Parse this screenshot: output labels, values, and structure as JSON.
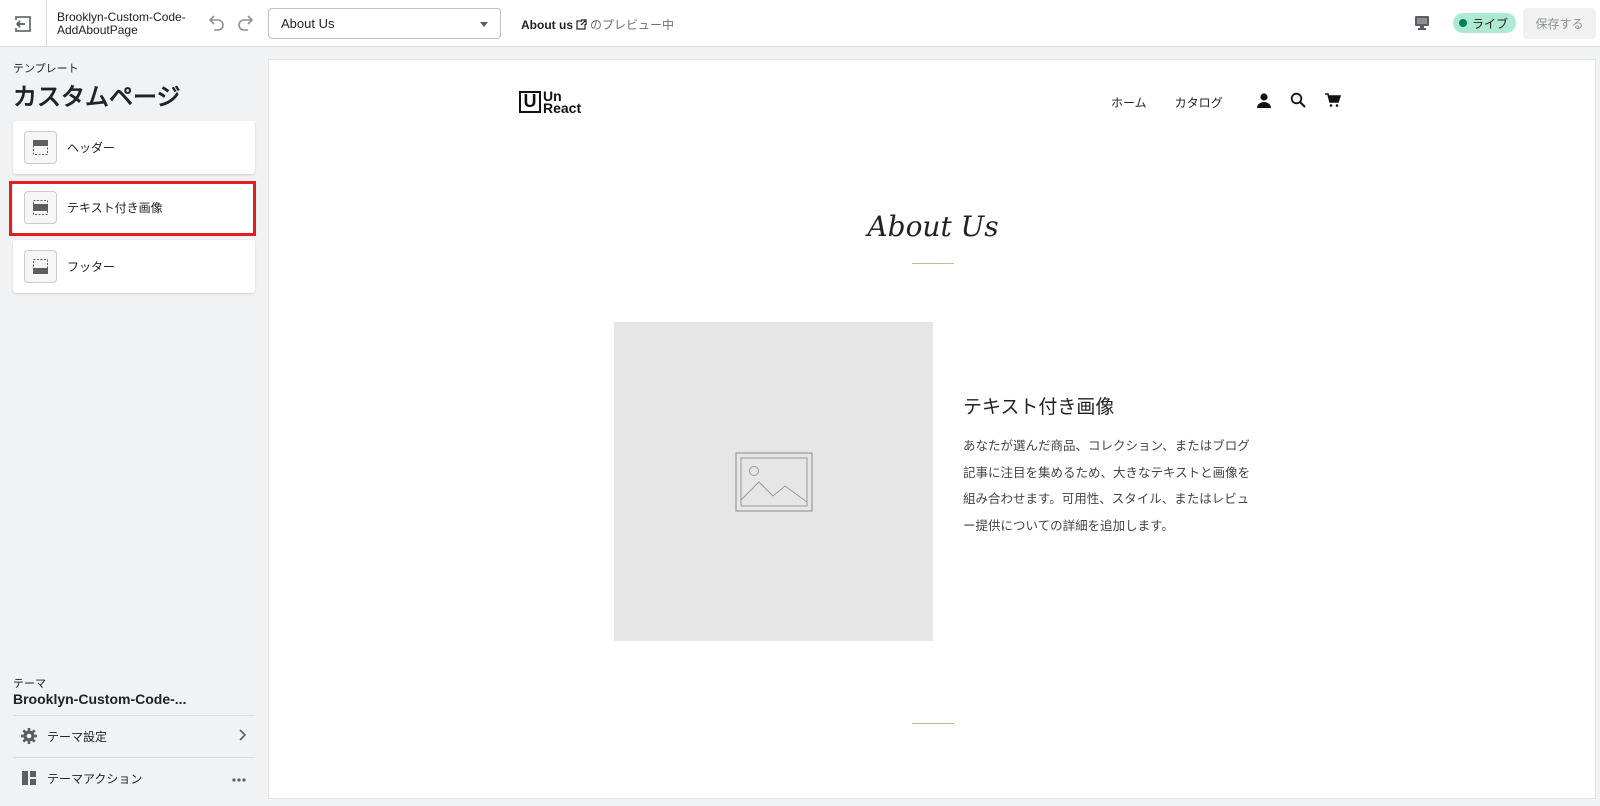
{
  "topbar": {
    "exit_icon": "exit-icon",
    "theme_name": "Brooklyn-Custom-Code-AddAboutPage",
    "undo_icon": "undo-icon",
    "redo_icon": "redo-icon",
    "page_select": {
      "selected": "About Us"
    },
    "preview_page": "About us",
    "preview_suffix": "のプレビュー中",
    "device_icon": "desktop-icon",
    "live_label": "ライブ",
    "save_label": "保存する"
  },
  "sidebar": {
    "template_label": "テンプレート",
    "template_title": "カスタムページ",
    "sections": [
      {
        "label": "ヘッダー",
        "icon": "header-section-icon"
      },
      {
        "label": "テキスト付き画像",
        "icon": "image-with-text-section-icon",
        "highlighted": true
      },
      {
        "label": "フッター",
        "icon": "footer-section-icon"
      }
    ],
    "theme_label": "テーマ",
    "theme_name": "Brooklyn-Custom-Code-...",
    "theme_settings_label": "テーマ設定",
    "theme_actions_label": "テーマアクション"
  },
  "preview": {
    "logo_text_line1": "Un",
    "logo_text_line2": "React",
    "nav": [
      "ホーム",
      "カタログ"
    ],
    "page_heading": "About Us",
    "image_with_text": {
      "heading": "テキスト付き画像",
      "body": "あなたが選んだ商品、コレクション、またはブログ記事に注目を集めるため、大きなテキストと画像を組み合わせます。可用性、スタイル、またはレビュー提供についての詳細を追加します。"
    }
  },
  "colors": {
    "highlight": "#e21f1f",
    "live_badge_bg": "#aee9d1",
    "accent_line": "#c9b78e"
  }
}
